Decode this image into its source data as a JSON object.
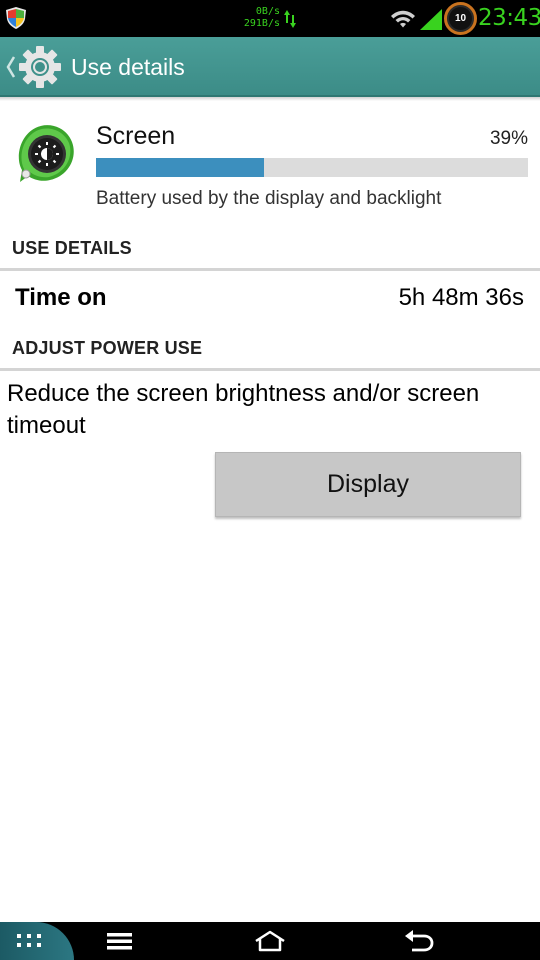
{
  "status_bar": {
    "net_up": "0B/s",
    "net_down": "291B/s",
    "battery_level": "10",
    "clock": "23:43",
    "icons": [
      "shield-icon",
      "data-arrows-icon",
      "wifi-icon",
      "signal-icon",
      "battery-ring-icon"
    ]
  },
  "action_bar": {
    "title": "Use details",
    "icons": [
      "up-caret-icon",
      "gear-icon"
    ]
  },
  "app": {
    "name": "Screen",
    "percent": "39%",
    "usage_fraction": 0.39,
    "description": "Battery used by the display and backlight",
    "icon": "screen-brightness-icon"
  },
  "use_details": {
    "header": "USE DETAILS",
    "time_on_label": "Time on",
    "time_on_value": "5h 48m 36s"
  },
  "adjust_power": {
    "header": "ADJUST POWER USE",
    "text": "Reduce the screen brightness and/or screen timeout",
    "button_label": "Display"
  },
  "nav_bar": {
    "icons": [
      "apps-grid-icon",
      "menu-icon",
      "home-icon",
      "back-icon"
    ]
  },
  "colors": {
    "status_green": "#39d21f",
    "action_bar": "#3f918b",
    "usage_bar": "#3c8fbe",
    "button_gray": "#c7c7c7"
  }
}
